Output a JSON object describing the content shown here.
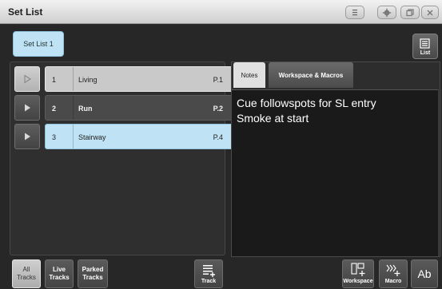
{
  "window": {
    "title": "Set List"
  },
  "setlist_tab": {
    "label": "Set List 1"
  },
  "list_button": {
    "label": "List"
  },
  "cues": [
    {
      "number": "1",
      "name": "Living",
      "page": "P.1",
      "state": "selected"
    },
    {
      "number": "2",
      "name": "Run",
      "page": "P.2",
      "state": "normal"
    },
    {
      "number": "3",
      "name": "Stairway",
      "page": "P.4",
      "state": "active"
    }
  ],
  "tabs": {
    "notes": "Notes",
    "workspace_macros": "Workspace & Macros"
  },
  "notes": {
    "lines": [
      "Cue followspots for SL entry",
      "Smoke at start"
    ]
  },
  "bottom": {
    "all_tracks_line1": "All",
    "all_tracks_line2": "Tracks",
    "live_tracks_line1": "Live",
    "live_tracks_line2": "Tracks",
    "parked_tracks_line1": "Parked",
    "parked_tracks_line2": "Tracks",
    "track": "Track",
    "workspace": "Workspace",
    "macro": "Macro",
    "text_icon": "Ab"
  },
  "icons": {
    "window_menu": "menu-icon",
    "window_settings": "gear-icon",
    "window_restore": "restore-icon",
    "window_close": "close-icon",
    "play": "play-icon"
  },
  "colors": {
    "accent_blue": "#bfe3f4",
    "panel_dark": "#272727"
  }
}
